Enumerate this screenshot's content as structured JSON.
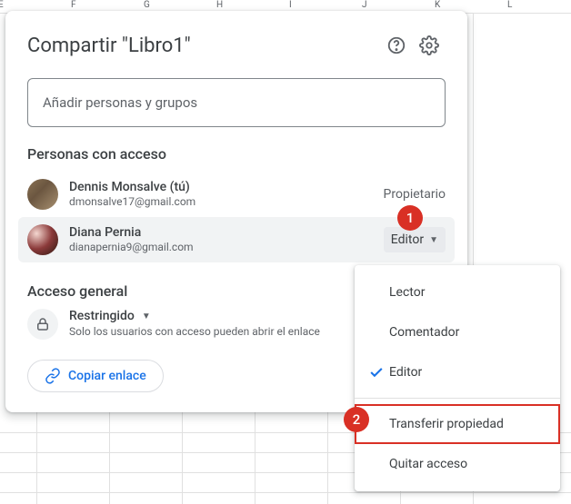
{
  "bg_columns": [
    "E",
    "F",
    "G",
    "H",
    "I",
    "J",
    "K",
    "L"
  ],
  "dialog": {
    "title": "Compartir \"Libro1\"",
    "add_placeholder": "Añadir personas y grupos",
    "access_title": "Personas con acceso",
    "people": [
      {
        "name": "Dennis Monsalve (tú)",
        "email": "dmonsalve17@gmail.com",
        "role": "Propietario"
      },
      {
        "name": "Diana Pernia",
        "email": "dianapernia9@gmail.com",
        "role": "Editor"
      }
    ],
    "general": {
      "title": "Acceso general",
      "restricted": "Restringido",
      "desc": "Solo los usuarios con acceso pueden abrir el enlace"
    },
    "copy_link": "Copiar enlace"
  },
  "menu": {
    "viewer": "Lector",
    "commenter": "Comentador",
    "editor": "Editor",
    "transfer": "Transferir propiedad",
    "remove": "Quitar acceso"
  },
  "annotations": {
    "one": "1",
    "two": "2"
  }
}
